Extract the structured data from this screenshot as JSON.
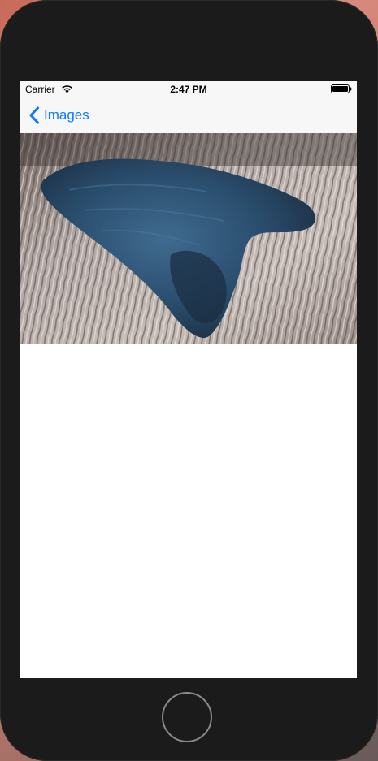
{
  "status_bar": {
    "carrier": "Carrier",
    "time": "2:47 PM",
    "wifi_icon": "wifi-icon",
    "battery_icon": "battery-icon"
  },
  "nav_bar": {
    "back_label": "Images",
    "back_icon": "chevron-left-icon",
    "accent_color": "#0a7aff"
  },
  "content": {
    "image_subject": "blue-dark-dune-over-ripples-photo"
  },
  "device": {
    "home_button": "home-button"
  }
}
